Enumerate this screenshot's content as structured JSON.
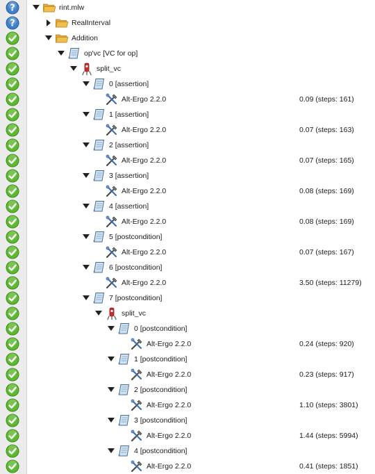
{
  "rows": [
    {
      "status": "unknown",
      "depth": 0,
      "arrow": "down",
      "icon": "folder",
      "label": "rint.mlw",
      "time": ""
    },
    {
      "status": "unknown",
      "depth": 1,
      "arrow": "right",
      "icon": "folder",
      "label": "RealInterval",
      "time": ""
    },
    {
      "status": "proved",
      "depth": 1,
      "arrow": "down",
      "icon": "folder",
      "label": "Addition",
      "time": ""
    },
    {
      "status": "proved",
      "depth": 2,
      "arrow": "down",
      "icon": "scroll",
      "label": "op'vc [VC for op]",
      "time": ""
    },
    {
      "status": "proved",
      "depth": 3,
      "arrow": "down",
      "icon": "transform",
      "label": "split_vc",
      "time": ""
    },
    {
      "status": "proved",
      "depth": 4,
      "arrow": "down",
      "icon": "scroll",
      "label": "0 [assertion]",
      "time": ""
    },
    {
      "status": "proved",
      "depth": 5,
      "arrow": "none",
      "icon": "prover",
      "label": "Alt-Ergo 2.2.0",
      "time": "0.09 (steps: 161)"
    },
    {
      "status": "proved",
      "depth": 4,
      "arrow": "down",
      "icon": "scroll",
      "label": "1 [assertion]",
      "time": ""
    },
    {
      "status": "proved",
      "depth": 5,
      "arrow": "none",
      "icon": "prover",
      "label": "Alt-Ergo 2.2.0",
      "time": "0.07 (steps: 163)"
    },
    {
      "status": "proved",
      "depth": 4,
      "arrow": "down",
      "icon": "scroll",
      "label": "2 [assertion]",
      "time": ""
    },
    {
      "status": "proved",
      "depth": 5,
      "arrow": "none",
      "icon": "prover",
      "label": "Alt-Ergo 2.2.0",
      "time": "0.07 (steps: 165)"
    },
    {
      "status": "proved",
      "depth": 4,
      "arrow": "down",
      "icon": "scroll",
      "label": "3 [assertion]",
      "time": ""
    },
    {
      "status": "proved",
      "depth": 5,
      "arrow": "none",
      "icon": "prover",
      "label": "Alt-Ergo 2.2.0",
      "time": "0.08 (steps: 169)"
    },
    {
      "status": "proved",
      "depth": 4,
      "arrow": "down",
      "icon": "scroll",
      "label": "4 [assertion]",
      "time": ""
    },
    {
      "status": "proved",
      "depth": 5,
      "arrow": "none",
      "icon": "prover",
      "label": "Alt-Ergo 2.2.0",
      "time": "0.08 (steps: 169)"
    },
    {
      "status": "proved",
      "depth": 4,
      "arrow": "down",
      "icon": "scroll",
      "label": "5 [postcondition]",
      "time": ""
    },
    {
      "status": "proved",
      "depth": 5,
      "arrow": "none",
      "icon": "prover",
      "label": "Alt-Ergo 2.2.0",
      "time": "0.07 (steps: 167)"
    },
    {
      "status": "proved",
      "depth": 4,
      "arrow": "down",
      "icon": "scroll",
      "label": "6 [postcondition]",
      "time": ""
    },
    {
      "status": "proved",
      "depth": 5,
      "arrow": "none",
      "icon": "prover",
      "label": "Alt-Ergo 2.2.0",
      "time": "3.50 (steps: 11279)"
    },
    {
      "status": "proved",
      "depth": 4,
      "arrow": "down",
      "icon": "scroll",
      "label": "7 [postcondition]",
      "time": ""
    },
    {
      "status": "proved",
      "depth": 5,
      "arrow": "down",
      "icon": "transform",
      "label": "split_vc",
      "time": ""
    },
    {
      "status": "proved",
      "depth": 6,
      "arrow": "down",
      "icon": "scroll",
      "label": "0 [postcondition]",
      "time": ""
    },
    {
      "status": "proved",
      "depth": 7,
      "arrow": "none",
      "icon": "prover",
      "label": "Alt-Ergo 2.2.0",
      "time": "0.24 (steps: 920)"
    },
    {
      "status": "proved",
      "depth": 6,
      "arrow": "down",
      "icon": "scroll",
      "label": "1 [postcondition]",
      "time": ""
    },
    {
      "status": "proved",
      "depth": 7,
      "arrow": "none",
      "icon": "prover",
      "label": "Alt-Ergo 2.2.0",
      "time": "0.23 (steps: 917)"
    },
    {
      "status": "proved",
      "depth": 6,
      "arrow": "down",
      "icon": "scroll",
      "label": "2 [postcondition]",
      "time": ""
    },
    {
      "status": "proved",
      "depth": 7,
      "arrow": "none",
      "icon": "prover",
      "label": "Alt-Ergo 2.2.0",
      "time": "1.10 (steps: 3801)"
    },
    {
      "status": "proved",
      "depth": 6,
      "arrow": "down",
      "icon": "scroll",
      "label": "3 [postcondition]",
      "time": ""
    },
    {
      "status": "proved",
      "depth": 7,
      "arrow": "none",
      "icon": "prover",
      "label": "Alt-Ergo 2.2.0",
      "time": "1.44 (steps: 5994)"
    },
    {
      "status": "proved",
      "depth": 6,
      "arrow": "down",
      "icon": "scroll",
      "label": "4 [postcondition]",
      "time": ""
    },
    {
      "status": "proved",
      "depth": 7,
      "arrow": "none",
      "icon": "prover",
      "label": "Alt-Ergo 2.2.0",
      "time": "0.41 (steps: 1851)"
    }
  ],
  "colors": {
    "proved": "#5cb82e",
    "unknown": "#3d7fc9",
    "folder": "#f2c04a",
    "scroll": "#cfe3f5",
    "arrow": "#222222"
  }
}
